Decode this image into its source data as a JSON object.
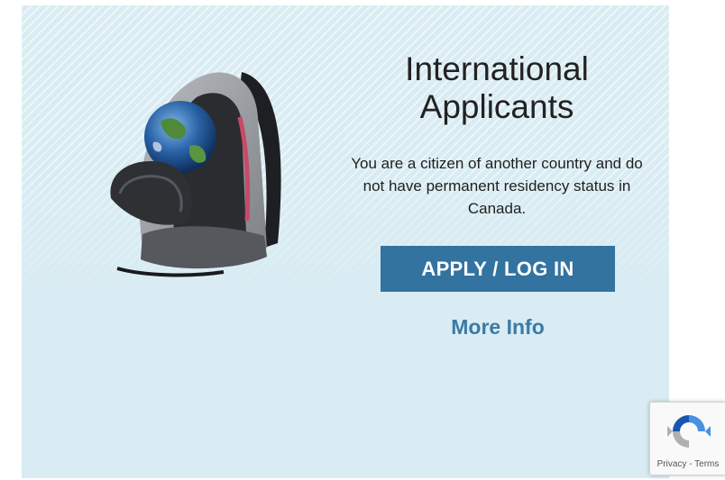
{
  "card": {
    "heading": "International Applicants",
    "description": "You are a citizen of another country and do not have permanent residency status in Canada.",
    "apply_button": "APPLY / LOG IN",
    "more_info_link": "More Info",
    "image": "backpack-with-globe-icon"
  },
  "recaptcha": {
    "privacy": "Privacy",
    "separator": " - ",
    "terms": "Terms",
    "icon": "recaptcha-icon"
  },
  "colors": {
    "card_background": "#d9ecf3",
    "button": "#3273a0",
    "link": "#3b7aa5"
  }
}
